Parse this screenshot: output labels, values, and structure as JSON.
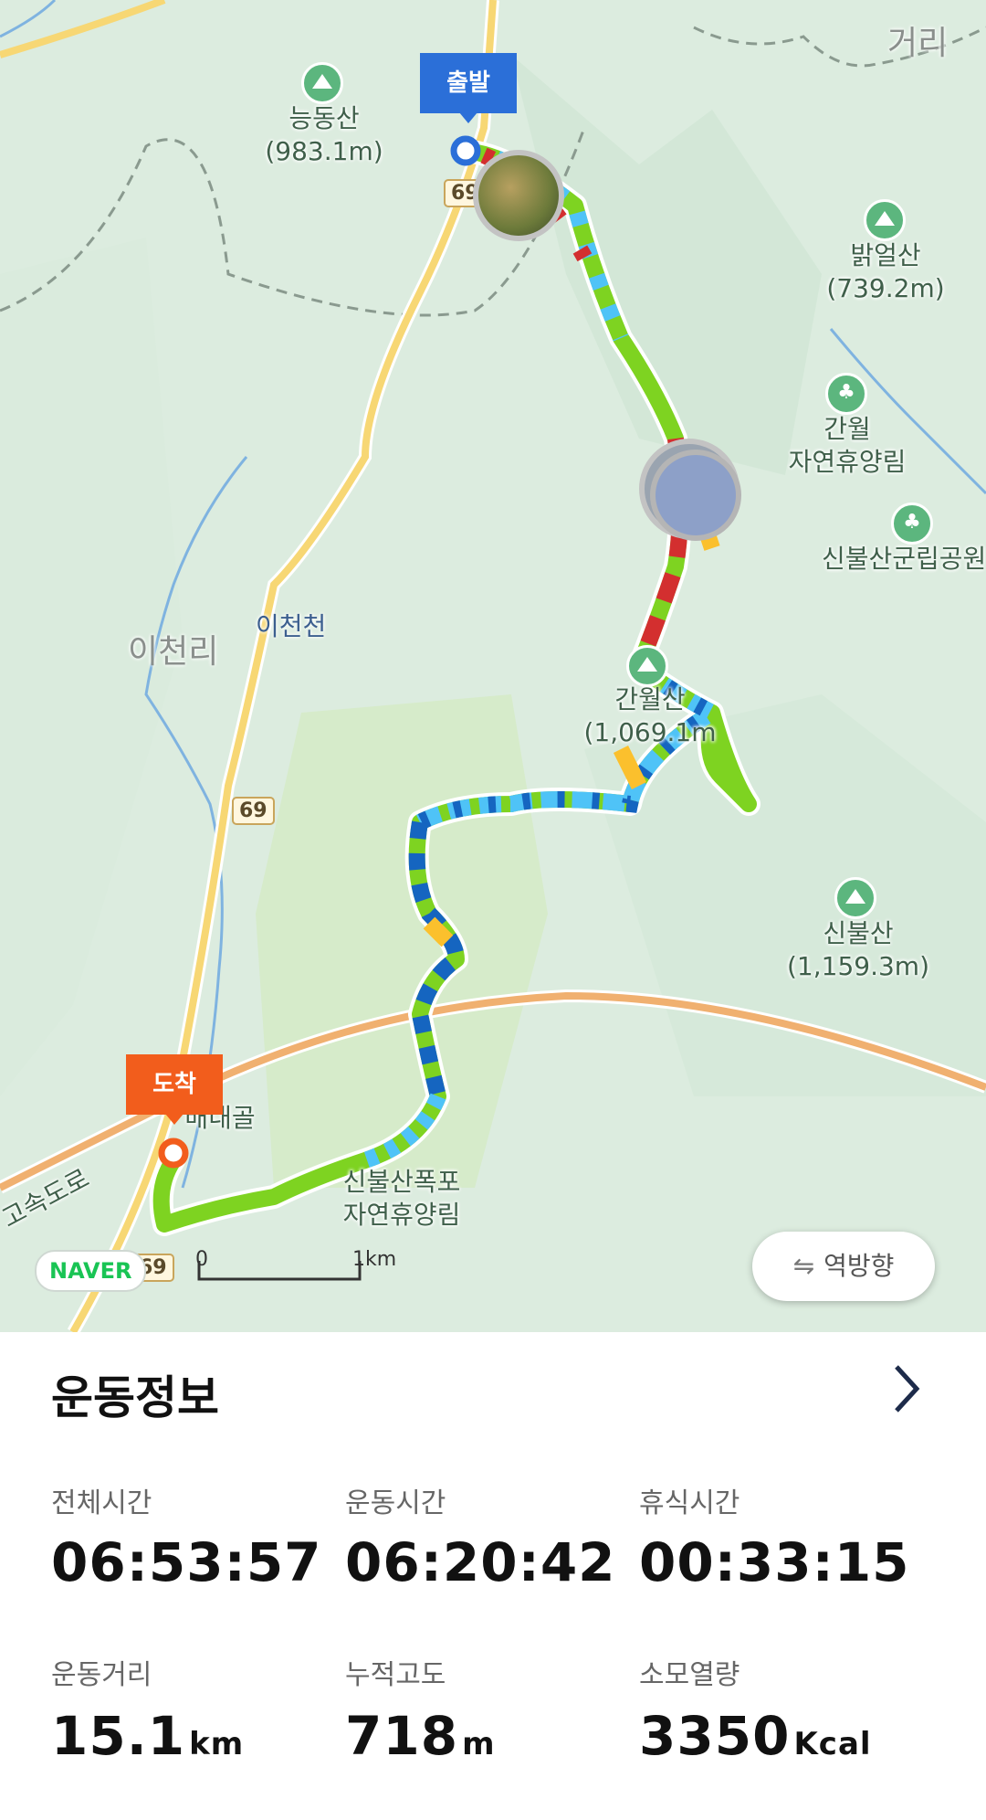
{
  "map": {
    "labels": {
      "peak_neungdong_name": "능동산",
      "peak_neungdong_elev": "(983.1m)",
      "peak_balkeol_name": "밝얼산",
      "peak_balkeol_elev": "(739.2m)",
      "forest_ganwol_1": "간월",
      "forest_ganwol_2": "자연휴양림",
      "forest_sinbul_park": "신불산군립공원",
      "peak_ganwol_name": "간월산",
      "peak_ganwol_elev": "(1,069.1m",
      "peak_sinbul_name": "신불산",
      "peak_sinbul_elev": "(1,159.3m)",
      "forest_waterfall_1": "신불산폭포",
      "forest_waterfall_2": "자연휴양림",
      "village_icheon": "이천리",
      "stream_icheon": "이천천",
      "place_baenaegol": "배내골",
      "corner_text": "거리",
      "expressway": "고속도로",
      "route_69_a": "69",
      "route_69_b": "69",
      "route_69_c": "69"
    },
    "start_flag": "출발",
    "end_flag": "도착",
    "naver_logo": "NAVER",
    "scale": {
      "zero": "0",
      "one": "1km"
    },
    "reverse_button": "역방향",
    "colors": {
      "start": "#2b6fd8",
      "end": "#f25d1c",
      "route_speeds": [
        "#7ed321",
        "#4fc3f7",
        "#1565c0",
        "#d32f2f",
        "#fbc02d"
      ]
    }
  },
  "stats": {
    "title": "운동정보",
    "items": [
      {
        "label": "전체시간",
        "value": "06:53:57",
        "unit": ""
      },
      {
        "label": "운동시간",
        "value": "06:20:42",
        "unit": ""
      },
      {
        "label": "휴식시간",
        "value": "00:33:15",
        "unit": ""
      },
      {
        "label": "운동거리",
        "value": "15.1",
        "unit": "km"
      },
      {
        "label": "누적고도",
        "value": "718",
        "unit": "m"
      },
      {
        "label": "소모열량",
        "value": "3350",
        "unit": "Kcal"
      }
    ]
  }
}
